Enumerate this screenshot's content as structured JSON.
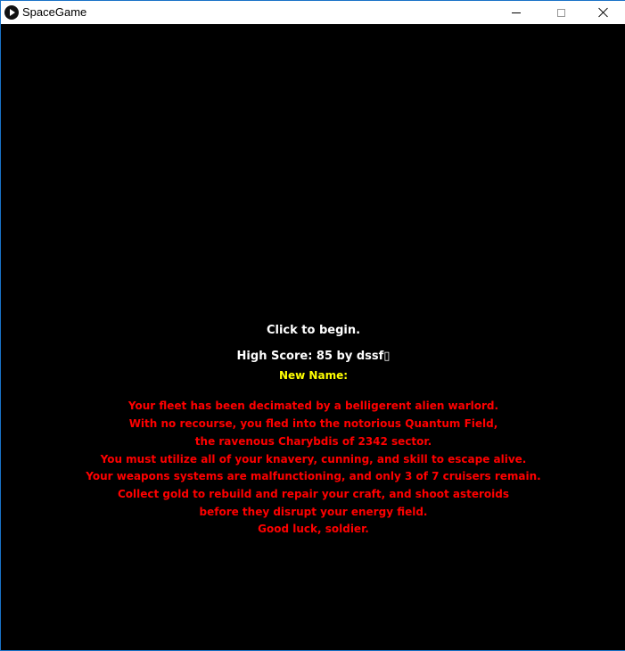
{
  "window": {
    "title": "SpaceGame"
  },
  "game": {
    "start_prompt": "Click to begin.",
    "high_score": "High Score: 85 by dssf▯",
    "new_name_label": "New Name:",
    "story": [
      "Your fleet has been decimated by a belligerent alien warlord.",
      "With no recourse, you fled into the notorious Quantum Field,",
      "the ravenous Charybdis of 2342 sector.",
      "You must utilize all of your knavery, cunning, and skill to escape alive.",
      "Your weapons systems are malfunctioning, and only 3 of 7 cruisers remain.",
      "Collect gold to rebuild and repair your craft, and shoot asteroids",
      "before they disrupt your energy field.",
      "Good luck, soldier."
    ]
  },
  "colors": {
    "background": "#000000",
    "prompt": "#ffffff",
    "name_label": "#ffff00",
    "story": "#ff0000"
  }
}
